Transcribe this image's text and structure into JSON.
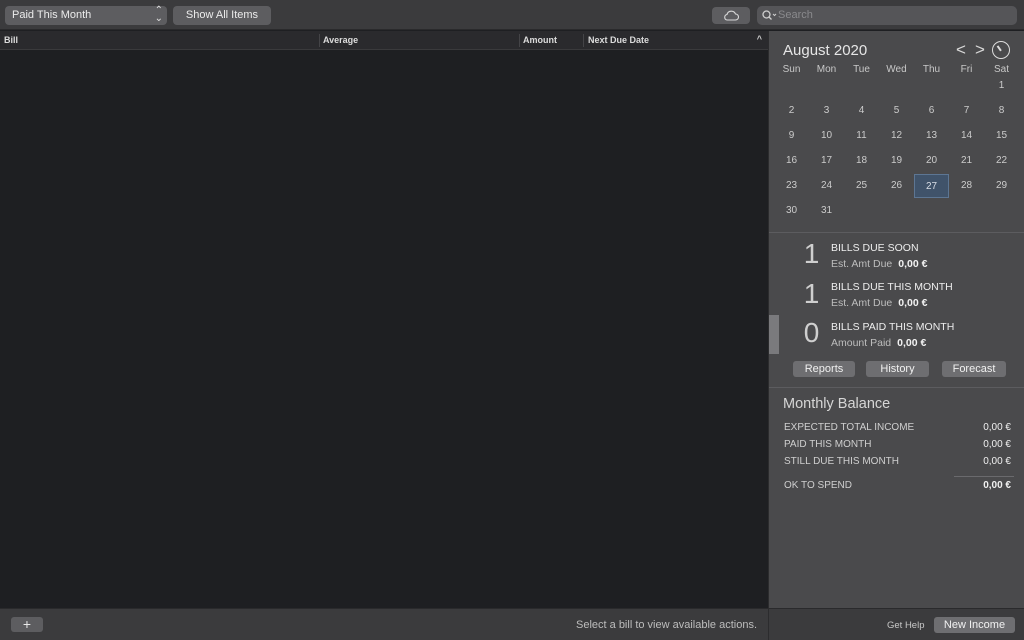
{
  "toolbar": {
    "filter_value": "Paid This Month",
    "show_all_label": "Show All Items",
    "cloud_icon": "cloud-icon",
    "search_placeholder": "Search"
  },
  "table": {
    "columns": [
      "Bill",
      "Average",
      "Amount",
      "Next Due Date"
    ],
    "sort_indicator": "^"
  },
  "footer": {
    "add_label": "+",
    "message": "Select a bill to view available actions."
  },
  "calendar": {
    "title": "August 2020",
    "prev_icon": "<",
    "next_icon": ">",
    "weekdays": [
      "Sun",
      "Mon",
      "Tue",
      "Wed",
      "Thu",
      "Fri",
      "Sat"
    ],
    "days": [
      "1",
      "2",
      "3",
      "4",
      "5",
      "6",
      "7",
      "8",
      "9",
      "10",
      "11",
      "12",
      "13",
      "14",
      "15",
      "16",
      "17",
      "18",
      "19",
      "20",
      "21",
      "22",
      "23",
      "24",
      "25",
      "26",
      "27",
      "28",
      "29",
      "30",
      "31"
    ],
    "selected_day": "27"
  },
  "summary": [
    {
      "count": "1",
      "title": "BILLS DUE SOON",
      "sub_label": "Est. Amt Due",
      "sub_value": "0,00 €"
    },
    {
      "count": "1",
      "title": "BILLS DUE THIS MONTH",
      "sub_label": "Est. Amt Due",
      "sub_value": "0,00 €"
    },
    {
      "count": "0",
      "title": "BILLS PAID THIS MONTH",
      "sub_label": "Amount Paid",
      "sub_value": "0,00 €"
    }
  ],
  "actions": {
    "reports": "Reports",
    "history": "History",
    "forecast": "Forecast"
  },
  "monthly_balance": {
    "title": "Monthly Balance",
    "rows": [
      {
        "label": "EXPECTED TOTAL INCOME",
        "value": "0,00 €"
      },
      {
        "label": "PAID THIS MONTH",
        "value": "0,00 €"
      },
      {
        "label": "STILL DUE THIS MONTH",
        "value": "0,00 €"
      }
    ],
    "total_label": "OK TO SPEND",
    "total_value": "0,00 €"
  },
  "right_footer": {
    "help": "Get Help",
    "new_income": "New Income"
  }
}
